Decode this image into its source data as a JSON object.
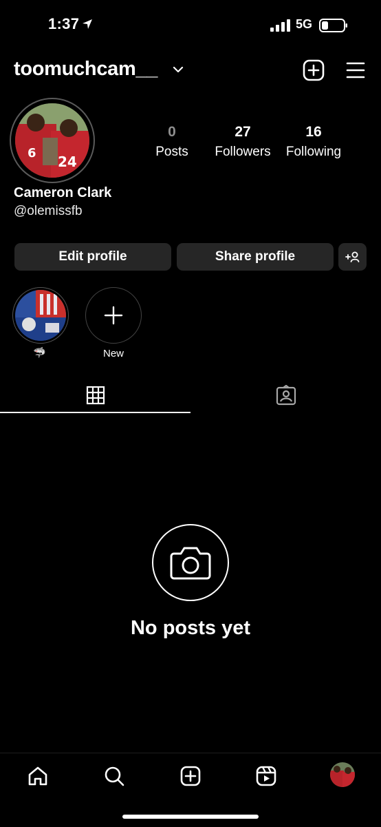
{
  "status_bar": {
    "time": "1:37",
    "network": "5G",
    "battery_level": 0.3
  },
  "header": {
    "username": "toomuchcam__"
  },
  "profile": {
    "full_name": "Cameron Clark",
    "handle": "@olemissfb",
    "stats": [
      {
        "value": "0",
        "label": "Posts"
      },
      {
        "value": "27",
        "label": "Followers"
      },
      {
        "value": "16",
        "label": "Following"
      }
    ]
  },
  "actions": {
    "edit_label": "Edit profile",
    "share_label": "Share profile"
  },
  "highlights": [
    {
      "label": "🦈"
    },
    {
      "label": "New"
    }
  ],
  "empty_state": {
    "text": "No posts yet"
  },
  "colors": {
    "background": "#000000",
    "button_bg": "#262626",
    "muted": "#8e8e8e"
  },
  "icons": [
    "location-arrow-icon",
    "signal-icon",
    "battery-icon",
    "chevron-down-icon",
    "add-square-icon",
    "hamburger-menu-icon",
    "add-person-icon",
    "plus-icon",
    "grid-icon",
    "tagged-icon",
    "camera-icon",
    "home-icon",
    "search-icon",
    "create-icon",
    "reels-icon"
  ]
}
